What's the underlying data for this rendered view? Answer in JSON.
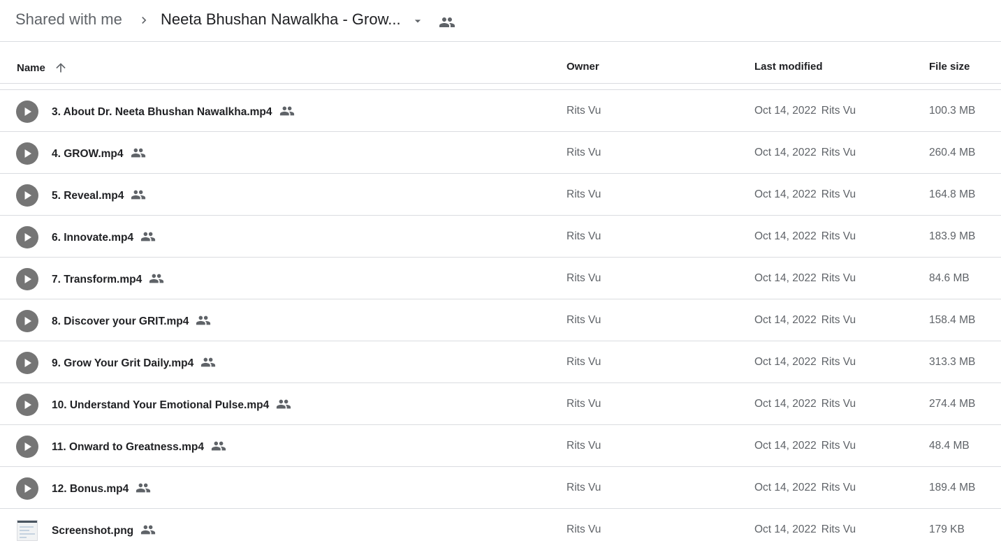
{
  "breadcrumb": {
    "root": "Shared with me",
    "current": "Neeta Bhushan Nawalkha - Grow..."
  },
  "columns": {
    "name": "Name",
    "owner": "Owner",
    "last_modified": "Last modified",
    "file_size": "File size"
  },
  "files": [
    {
      "name": "3. About Dr. Neeta Bhushan Nawalkha.mp4",
      "type": "video",
      "owner": "Rits Vu",
      "modified": "Oct 14, 2022",
      "modified_by": "Rits Vu",
      "size": "100.3 MB"
    },
    {
      "name": "4. GROW.mp4",
      "type": "video",
      "owner": "Rits Vu",
      "modified": "Oct 14, 2022",
      "modified_by": "Rits Vu",
      "size": "260.4 MB"
    },
    {
      "name": "5. Reveal.mp4",
      "type": "video",
      "owner": "Rits Vu",
      "modified": "Oct 14, 2022",
      "modified_by": "Rits Vu",
      "size": "164.8 MB"
    },
    {
      "name": "6. Innovate.mp4",
      "type": "video",
      "owner": "Rits Vu",
      "modified": "Oct 14, 2022",
      "modified_by": "Rits Vu",
      "size": "183.9 MB"
    },
    {
      "name": "7. Transform.mp4",
      "type": "video",
      "owner": "Rits Vu",
      "modified": "Oct 14, 2022",
      "modified_by": "Rits Vu",
      "size": "84.6 MB"
    },
    {
      "name": "8. Discover your GRIT.mp4",
      "type": "video",
      "owner": "Rits Vu",
      "modified": "Oct 14, 2022",
      "modified_by": "Rits Vu",
      "size": "158.4 MB"
    },
    {
      "name": "9. Grow Your Grit Daily.mp4",
      "type": "video",
      "owner": "Rits Vu",
      "modified": "Oct 14, 2022",
      "modified_by": "Rits Vu",
      "size": "313.3 MB"
    },
    {
      "name": "10. Understand Your Emotional Pulse.mp4",
      "type": "video",
      "owner": "Rits Vu",
      "modified": "Oct 14, 2022",
      "modified_by": "Rits Vu",
      "size": "274.4 MB"
    },
    {
      "name": "11. Onward to Greatness.mp4",
      "type": "video",
      "owner": "Rits Vu",
      "modified": "Oct 14, 2022",
      "modified_by": "Rits Vu",
      "size": "48.4 MB"
    },
    {
      "name": "12. Bonus.mp4",
      "type": "video",
      "owner": "Rits Vu",
      "modified": "Oct 14, 2022",
      "modified_by": "Rits Vu",
      "size": "189.4 MB"
    },
    {
      "name": "Screenshot.png",
      "type": "image",
      "owner": "Rits Vu",
      "modified": "Oct 14, 2022",
      "modified_by": "Rits Vu",
      "size": "179 KB"
    }
  ],
  "icons": {
    "video": "play-circle-icon",
    "image": "image-thumbnail-icon",
    "shared": "people-icon",
    "sort": "arrow-up-icon",
    "separator": "chevron-right-icon",
    "dropdown": "caret-down-icon"
  },
  "colors": {
    "text_primary": "#202124",
    "text_secondary": "#5f6368",
    "divider": "#dadce0",
    "icon_gray": "#757575"
  }
}
